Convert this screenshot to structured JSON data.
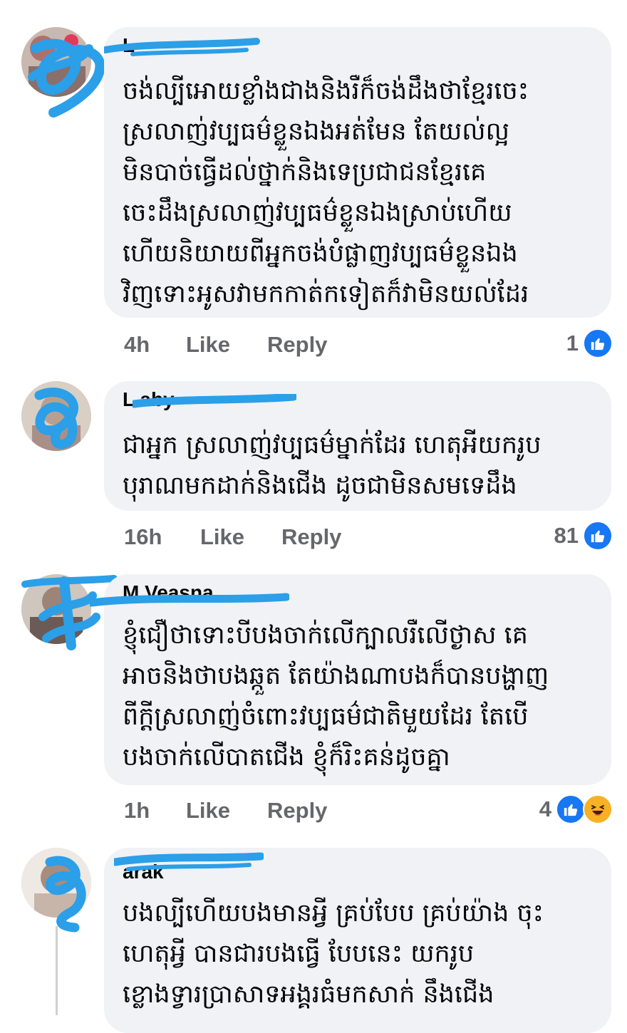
{
  "colors": {
    "bubble_bg": "#f0f2f5",
    "text": "#050505",
    "meta": "#65676b",
    "like_blue": "#1877f2",
    "redaction_blue": "#2b9fe8"
  },
  "comments": [
    {
      "author": "L",
      "text": "ចង់ល្បីអោយខ្លាំងជាងនិងរឺក៏ចង់ដឹងថាខ្មែរចេះ\nស្រលាញ់វប្បធម៌ខ្លួនឯងអត់មែន តែយល់ល្អ\nមិនបាច់ធ្វើដល់ថ្នាក់និងទេប្រជាជនខ្មែរគេ\nចេះដឹងស្រលាញ់វប្បធម៌ខ្លួនឯងស្រាប់ហើយ\nហើយនិយាយពីអ្នកចង់បំផ្លាញវប្បធម៌ខ្លួនឯង\nវិញទោះអូសវាមកកាត់កទៀតក៏វាមិនយល់ដែរ",
      "time": "4h",
      "like_label": "Like",
      "reply_label": "Reply",
      "reaction_count": "1",
      "reactions": [
        "like-icon"
      ]
    },
    {
      "author": "L           aby",
      "text": "ជាអ្នក ស្រលាញ់វប្បធម៌ម្នាក់ដែរ ហេតុអីយករូប\nបុរាណមកដាក់និងជើង ដូចជាមិនសមទេដឹង",
      "time": "16h",
      "like_label": "Like",
      "reply_label": "Reply",
      "reaction_count": "81",
      "reactions": [
        "like-icon"
      ]
    },
    {
      "author": "M       Veasna",
      "text": "ខ្ញុំជឿថាទោះបីបងចាក់លើក្បាលរឺលើថ្ងាស គេ\nអាចនិងថាបងឆ្កួត តែយ៉ាងណាបងក៏បានបង្ហាញ\nពីក្តីស្រលាញ់ចំពោះវប្បធម៌ជាតិមួយដែរ តែបើ\nបងចាក់លើបាតជើង ខ្ញុំក៏រិះគន់ដូចគ្នា",
      "time": "1h",
      "like_label": "Like",
      "reply_label": "Reply",
      "reaction_count": "4",
      "reactions": [
        "like-icon",
        "haha-icon"
      ]
    },
    {
      "author": "         arak",
      "text": "បងល្បីហើយបងមានអ្វី គ្រប់បែប គ្រប់យ៉ាង ចុះ\nហេតុអ្វី បានជារបងធ្វើ បែបនេះ យករូប\nខ្លោងទ្វារប្រាសាទអង្គរធំមកសាក់ នឹងជើង"
    }
  ]
}
